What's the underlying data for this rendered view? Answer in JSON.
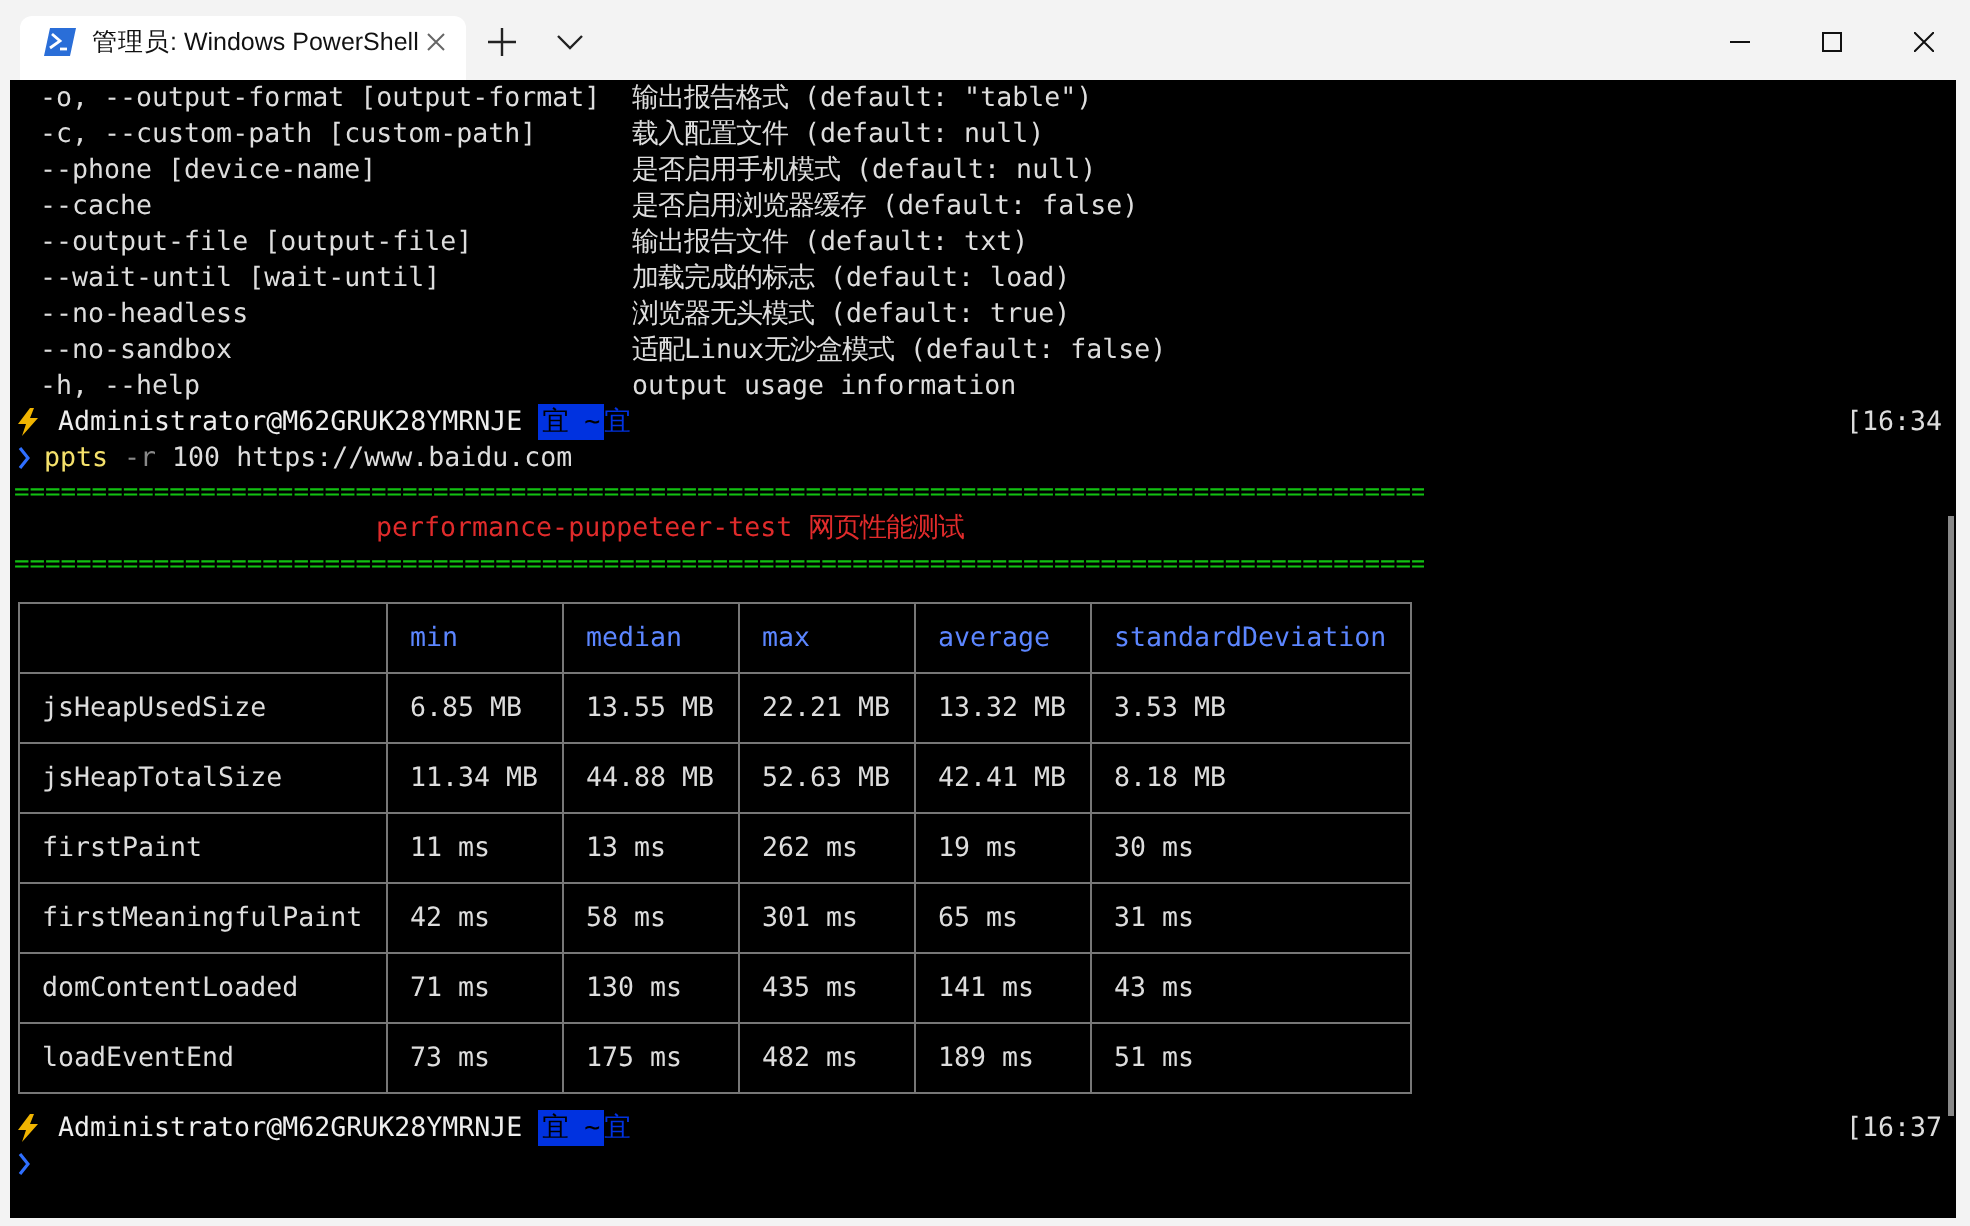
{
  "window": {
    "tab_title": "管理员: Windows PowerShell"
  },
  "help_options": [
    {
      "flag": "-o, --output-format [output-format]",
      "description": "输出报告格式 (default: \"table\")"
    },
    {
      "flag": "-c, --custom-path [custom-path]",
      "description": "载入配置文件 (default: null)"
    },
    {
      "flag": "--phone [device-name]",
      "description": "是否启用手机模式 (default: null)"
    },
    {
      "flag": "--cache",
      "description": "是否启用浏览器缓存 (default: false)"
    },
    {
      "flag": "--output-file [output-file]",
      "description": "输出报告文件 (default: txt)"
    },
    {
      "flag": "--wait-until [wait-until]",
      "description": "加载完成的标志 (default: load)"
    },
    {
      "flag": "--no-headless",
      "description": "浏览器无头模式 (default: true)"
    },
    {
      "flag": "--no-sandbox",
      "description": "适配Linux无沙盒模式 (default: false)"
    },
    {
      "flag": "-h, --help",
      "description": "output usage information"
    }
  ],
  "prompts": [
    {
      "user": "Administrator@M62GRUK28YMRNJE",
      "segment_glyph": "宜",
      "path": "~",
      "end_glyph": "宜",
      "time": "[16:34",
      "command": {
        "program": "ppts",
        "flag": "-r",
        "args": "100 https://www.baidu.com"
      }
    },
    {
      "user": "Administrator@M62GRUK28YMRNJE",
      "segment_glyph": "宜",
      "path": "~",
      "end_glyph": "宜",
      "time": "[16:37"
    }
  ],
  "banner": {
    "rule": "===========================================================================================",
    "title": "performance-puppeteer-test 网页性能测试"
  },
  "table": {
    "columns": [
      "",
      "min",
      "median",
      "max",
      "average",
      "standardDeviation"
    ],
    "rows": [
      [
        "jsHeapUsedSize",
        "6.85 MB",
        "13.55 MB",
        "22.21 MB",
        "13.32 MB",
        "3.53 MB"
      ],
      [
        "jsHeapTotalSize",
        "11.34 MB",
        "44.88 MB",
        "52.63 MB",
        "42.41 MB",
        "8.18 MB"
      ],
      [
        "firstPaint",
        "11 ms",
        "13 ms",
        "262 ms",
        "19 ms",
        "30 ms"
      ],
      [
        "firstMeaningfulPaint",
        "42 ms",
        "58 ms",
        "301 ms",
        "65 ms",
        "31 ms"
      ],
      [
        "domContentLoaded",
        "71 ms",
        "130 ms",
        "435 ms",
        "141 ms",
        "43 ms"
      ],
      [
        "loadEventEnd",
        "73 ms",
        "175 ms",
        "482 ms",
        "189 ms",
        "51 ms"
      ]
    ]
  }
}
